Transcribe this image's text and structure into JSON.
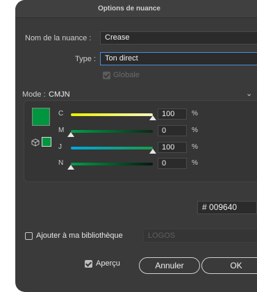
{
  "dialog": {
    "title": "Options de nuance"
  },
  "swatch_name": {
    "label": "Nom de la nuance :",
    "value": "Crease"
  },
  "type": {
    "label": "Type :",
    "value": "Ton direct",
    "arrow": "⌄"
  },
  "globale": {
    "label": "Globale",
    "checked": true,
    "enabled": false
  },
  "mode": {
    "label": "Mode :",
    "value": "CMJN",
    "arrow": "⌄"
  },
  "preview_color": "#009640",
  "channels": [
    {
      "letter": "C",
      "value": "100",
      "unit": "%",
      "fraction": 1.0,
      "gradient": "linear-gradient(90deg,#e9f100,#f7f5c0)"
    },
    {
      "letter": "M",
      "value": "0",
      "unit": "%",
      "fraction": 0.0,
      "gradient": "linear-gradient(90deg,#00a04a,#0a2a16)"
    },
    {
      "letter": "J",
      "value": "100",
      "unit": "%",
      "fraction": 1.0,
      "gradient": "linear-gradient(90deg,#00a8e0,#1a9a4a)"
    },
    {
      "letter": "N",
      "value": "0",
      "unit": "%",
      "fraction": 0.0,
      "gradient": "linear-gradient(90deg,#00a04a,#061a0e)"
    }
  ],
  "hex": {
    "prefix": "#",
    "value": "009640"
  },
  "library": {
    "label": "Ajouter à ma bibliothèque",
    "checked": false,
    "select_value": "LOGOS",
    "arrow": "⌄"
  },
  "apercu": {
    "label": "Aperçu",
    "checked": true
  },
  "buttons": {
    "cancel": "Annuler",
    "ok": "OK"
  }
}
